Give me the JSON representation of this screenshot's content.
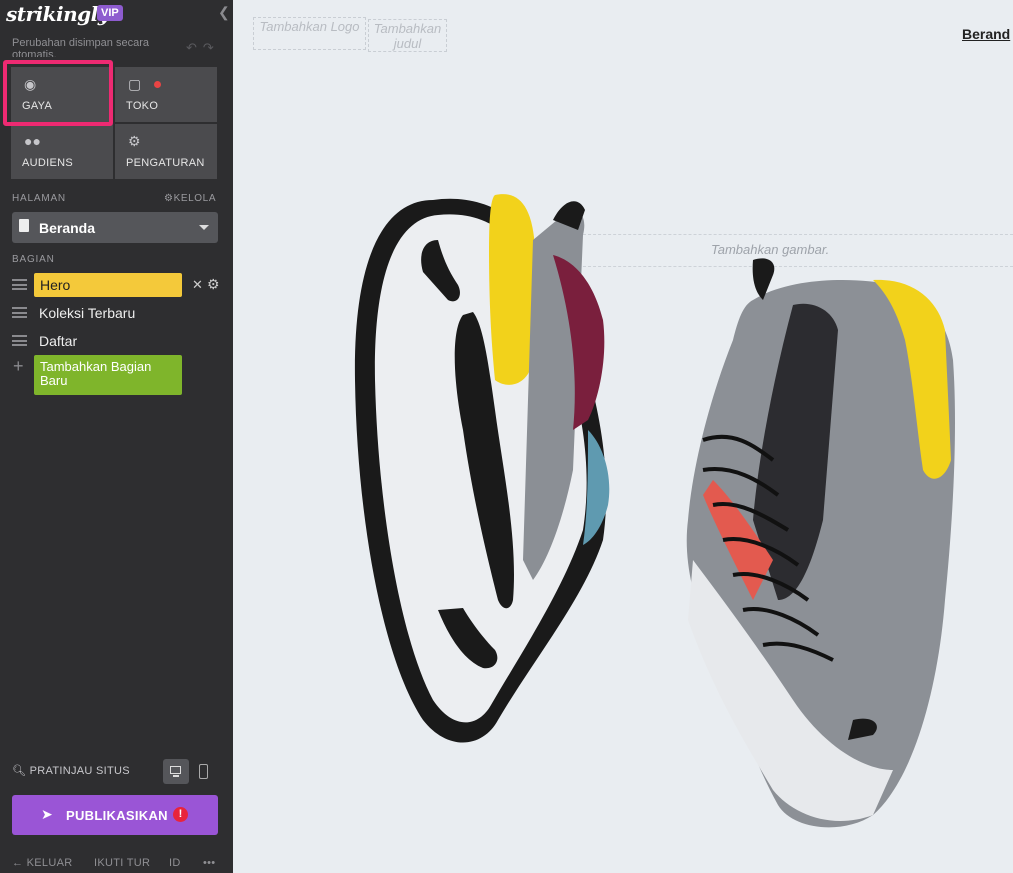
{
  "app": {
    "logo": "strikingly",
    "badge": "VIP"
  },
  "sidebar": {
    "autosave_text": "Perubahan disimpan secara otomatis.",
    "tiles": [
      {
        "label": "GAYA",
        "icon": "palette-icon"
      },
      {
        "label": "TOKO",
        "icon": "shopping-bag-icon"
      },
      {
        "label": "AUDIENS",
        "icon": "users-icon"
      },
      {
        "label": "PENGATURAN",
        "icon": "gear-icon"
      }
    ],
    "pages_label": "HALAMAN",
    "manage_label": "KELOLA",
    "current_page": "Beranda",
    "sections_label": "BAGIAN",
    "sections": [
      {
        "label": "Hero"
      },
      {
        "label": "Koleksi Terbaru"
      },
      {
        "label": "Daftar"
      }
    ],
    "add_section_label": "Tambahkan Bagian Baru",
    "preview_label": "PRATINJAU SITUS",
    "publish_label": "PUBLIKASIKAN",
    "footer": {
      "exit": "KELUAR",
      "tour": "IKUTI TUR",
      "lang": "ID",
      "more": "•••"
    }
  },
  "canvas": {
    "add_logo": "Tambahkan Logo",
    "add_title": "Tambahkan judul",
    "nav_item": "Berand",
    "add_image": "Tambahkan gambar."
  },
  "colors": {
    "sidebar_bg": "#2e2e30",
    "highlight": "#ee2a72",
    "hero_section": "#f4c93a",
    "add_section": "#7fb52b",
    "publish": "#9a55d6"
  }
}
